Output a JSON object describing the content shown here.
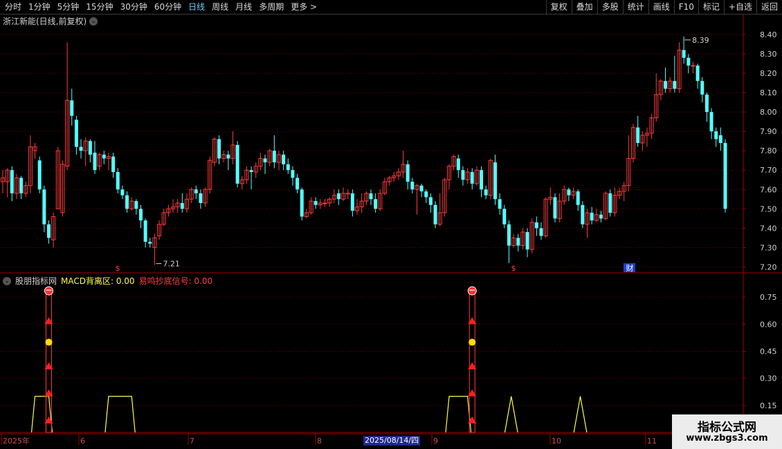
{
  "toolbar": {
    "left_items": [
      "分时",
      "1分钟",
      "5分钟",
      "15分钟",
      "30分钟",
      "60分钟",
      "日线",
      "周线",
      "月线",
      "多周期",
      "更多 >"
    ],
    "active_index": 6,
    "right_items": [
      "复权",
      "叠加",
      "多股",
      "统计",
      "画线",
      "F10",
      "标记",
      "+自选",
      "返回"
    ]
  },
  "main": {
    "title": "浙江新能(日线,前复权)",
    "high_label": "8.39",
    "low_label": "7.21",
    "markers": [
      "$",
      "$",
      "财"
    ],
    "y_ticks": [
      "8.40",
      "8.30",
      "8.20",
      "8.10",
      "8.00",
      "7.90",
      "7.80",
      "7.70",
      "7.60",
      "7.50",
      "7.40",
      "7.30",
      "7.20"
    ]
  },
  "sub": {
    "name": "股朋指标网",
    "line1": "MACD背离区: 0.00",
    "line2": "易鸣抄底信号: 0.00",
    "y_ticks": [
      "0.75",
      "0.60",
      "0.45",
      "0.30",
      "0.15"
    ]
  },
  "xaxis": {
    "labels": [
      "2025年",
      "6",
      "7",
      "8",
      "9",
      "10",
      "11"
    ],
    "selected_date": "2025/08/14/四"
  },
  "watermark": {
    "line1": "指标公式网",
    "line2": "www.zbgs3.com"
  },
  "colors": {
    "up": "#ff3b3b",
    "down": "#54ffff",
    "grid": "#7a0000",
    "axis": "#a00000",
    "yellow": "#ffff40"
  },
  "chart_data": {
    "type": "candlestick",
    "price_range": [
      7.18,
      8.45
    ],
    "indicator_range": [
      0,
      0.85
    ],
    "candles": [
      [
        7.64,
        7.66,
        7.58,
        7.7
      ],
      [
        7.64,
        7.7,
        7.56,
        7.71
      ],
      [
        7.7,
        7.58,
        7.54,
        7.72
      ],
      [
        7.58,
        7.66,
        7.55,
        7.68
      ],
      [
        7.66,
        7.58,
        7.55,
        7.67
      ],
      [
        7.58,
        7.62,
        7.56,
        7.64
      ],
      [
        7.62,
        7.82,
        7.58,
        7.88
      ],
      [
        7.8,
        7.82,
        7.76,
        7.84
      ],
      [
        7.75,
        7.6,
        7.58,
        7.77
      ],
      [
        7.6,
        7.42,
        7.38,
        7.62
      ],
      [
        7.42,
        7.35,
        7.32,
        7.44
      ],
      [
        7.34,
        7.46,
        7.3,
        7.48
      ],
      [
        7.5,
        7.8,
        7.5,
        7.82
      ],
      [
        7.48,
        7.73,
        7.46,
        7.75
      ],
      [
        7.72,
        8.06,
        7.7,
        8.36
      ],
      [
        8.06,
        7.98,
        7.93,
        8.12
      ],
      [
        7.96,
        7.82,
        7.78,
        7.98
      ],
      [
        7.82,
        7.8,
        7.76,
        7.86
      ],
      [
        7.8,
        7.85,
        7.72,
        7.87
      ],
      [
        7.85,
        7.78,
        7.74,
        7.86
      ],
      [
        7.79,
        7.7,
        7.68,
        7.85
      ],
      [
        7.72,
        7.78,
        7.7,
        7.79
      ],
      [
        7.78,
        7.76,
        7.73,
        7.8
      ],
      [
        7.76,
        7.77,
        7.7,
        7.79
      ],
      [
        7.77,
        7.69,
        7.66,
        7.79
      ],
      [
        7.69,
        7.6,
        7.58,
        7.71
      ],
      [
        7.6,
        7.57,
        7.55,
        7.62
      ],
      [
        7.57,
        7.5,
        7.48,
        7.59
      ],
      [
        7.5,
        7.54,
        7.49,
        7.56
      ],
      [
        7.54,
        7.5,
        7.47,
        7.55
      ],
      [
        7.5,
        7.44,
        7.4,
        7.52
      ],
      [
        7.44,
        7.33,
        7.3,
        7.45
      ],
      [
        7.33,
        7.32,
        7.3,
        7.35
      ],
      [
        7.3,
        7.35,
        7.21,
        7.37
      ],
      [
        7.36,
        7.42,
        7.34,
        7.44
      ],
      [
        7.42,
        7.48,
        7.41,
        7.5
      ],
      [
        7.48,
        7.5,
        7.46,
        7.52
      ],
      [
        7.5,
        7.51,
        7.48,
        7.55
      ],
      [
        7.51,
        7.53,
        7.48,
        7.55
      ],
      [
        7.53,
        7.5,
        7.48,
        7.58
      ],
      [
        7.5,
        7.55,
        7.48,
        7.58
      ],
      [
        7.55,
        7.6,
        7.53,
        7.61
      ],
      [
        7.6,
        7.58,
        7.55,
        7.62
      ],
      [
        7.58,
        7.53,
        7.5,
        7.6
      ],
      [
        7.53,
        7.6,
        7.51,
        7.61
      ],
      [
        7.6,
        7.75,
        7.58,
        7.77
      ],
      [
        7.74,
        7.86,
        7.72,
        7.87
      ],
      [
        7.86,
        7.76,
        7.73,
        7.88
      ],
      [
        7.76,
        7.78,
        7.74,
        7.8
      ],
      [
        7.78,
        7.76,
        7.7,
        7.8
      ],
      [
        7.76,
        7.83,
        7.73,
        7.9
      ],
      [
        7.83,
        7.63,
        7.61,
        7.85
      ],
      [
        7.63,
        7.65,
        7.6,
        7.67
      ],
      [
        7.65,
        7.7,
        7.63,
        7.72
      ],
      [
        7.7,
        7.69,
        7.6,
        7.72
      ],
      [
        7.69,
        7.72,
        7.66,
        7.74
      ],
      [
        7.72,
        7.76,
        7.7,
        7.79
      ],
      [
        7.76,
        7.74,
        7.68,
        7.78
      ],
      [
        7.74,
        7.8,
        7.72,
        7.81
      ],
      [
        7.8,
        7.74,
        7.71,
        7.88
      ],
      [
        7.74,
        7.78,
        7.7,
        7.8
      ],
      [
        7.78,
        7.73,
        7.7,
        7.8
      ],
      [
        7.73,
        7.7,
        7.68,
        7.76
      ],
      [
        7.7,
        7.66,
        7.62,
        7.72
      ],
      [
        7.66,
        7.6,
        7.58,
        7.68
      ],
      [
        7.6,
        7.46,
        7.44,
        7.61
      ],
      [
        7.46,
        7.48,
        7.45,
        7.5
      ],
      [
        7.48,
        7.54,
        7.47,
        7.56
      ],
      [
        7.54,
        7.52,
        7.5,
        7.56
      ],
      [
        7.52,
        7.53,
        7.5,
        7.55
      ],
      [
        7.53,
        7.53,
        7.51,
        7.55
      ],
      [
        7.53,
        7.55,
        7.51,
        7.56
      ],
      [
        7.55,
        7.57,
        7.53,
        7.6
      ],
      [
        7.58,
        7.55,
        7.52,
        7.6
      ],
      [
        7.55,
        7.58,
        7.54,
        7.61
      ],
      [
        7.58,
        7.58,
        7.55,
        7.6
      ],
      [
        7.58,
        7.49,
        7.46,
        7.6
      ],
      [
        7.49,
        7.51,
        7.47,
        7.55
      ],
      [
        7.51,
        7.54,
        7.48,
        7.58
      ],
      [
        7.54,
        7.58,
        7.52,
        7.59
      ],
      [
        7.58,
        7.55,
        7.52,
        7.6
      ],
      [
        7.55,
        7.5,
        7.48,
        7.58
      ],
      [
        7.5,
        7.58,
        7.49,
        7.6
      ],
      [
        7.58,
        7.64,
        7.57,
        7.66
      ],
      [
        7.64,
        7.66,
        7.62,
        7.67
      ],
      [
        7.66,
        7.67,
        7.64,
        7.69
      ],
      [
        7.67,
        7.69,
        7.65,
        7.71
      ],
      [
        7.69,
        7.73,
        7.66,
        7.8
      ],
      [
        7.73,
        7.64,
        7.6,
        7.75
      ],
      [
        7.64,
        7.6,
        7.58,
        7.66
      ],
      [
        7.6,
        7.62,
        7.47,
        7.63
      ],
      [
        7.62,
        7.59,
        7.56,
        7.63
      ],
      [
        7.59,
        7.56,
        7.53,
        7.6
      ],
      [
        7.56,
        7.52,
        7.48,
        7.58
      ],
      [
        7.52,
        7.42,
        7.4,
        7.54
      ],
      [
        7.42,
        7.48,
        7.41,
        7.58
      ],
      [
        7.48,
        7.65,
        7.46,
        7.66
      ],
      [
        7.65,
        7.72,
        7.6,
        7.73
      ],
      [
        7.72,
        7.77,
        7.7,
        7.78
      ],
      [
        7.76,
        7.7,
        7.66,
        7.78
      ],
      [
        7.7,
        7.65,
        7.62,
        7.72
      ],
      [
        7.65,
        7.69,
        7.63,
        7.71
      ],
      [
        7.69,
        7.63,
        7.6,
        7.71
      ],
      [
        7.63,
        7.7,
        7.62,
        7.72
      ],
      [
        7.7,
        7.6,
        7.56,
        7.72
      ],
      [
        7.6,
        7.57,
        7.55,
        7.62
      ],
      [
        7.57,
        7.75,
        7.55,
        7.76
      ],
      [
        7.74,
        7.55,
        7.52,
        7.78
      ],
      [
        7.55,
        7.5,
        7.47,
        7.58
      ],
      [
        7.5,
        7.42,
        7.4,
        7.52
      ],
      [
        7.42,
        7.31,
        7.22,
        7.44
      ],
      [
        7.31,
        7.35,
        7.3,
        7.37
      ],
      [
        7.35,
        7.31,
        7.28,
        7.37
      ],
      [
        7.31,
        7.38,
        7.29,
        7.4
      ],
      [
        7.38,
        7.29,
        7.25,
        7.4
      ],
      [
        7.29,
        7.43,
        7.27,
        7.45
      ],
      [
        7.43,
        7.4,
        7.36,
        7.46
      ],
      [
        7.4,
        7.36,
        7.34,
        7.43
      ],
      [
        7.36,
        7.55,
        7.35,
        7.56
      ],
      [
        7.55,
        7.56,
        7.52,
        7.61
      ],
      [
        7.56,
        7.45,
        7.43,
        7.58
      ],
      [
        7.45,
        7.54,
        7.43,
        7.58
      ],
      [
        7.54,
        7.6,
        7.52,
        7.62
      ],
      [
        7.6,
        7.57,
        7.54,
        7.61
      ],
      [
        7.57,
        7.59,
        7.55,
        7.61
      ],
      [
        7.59,
        7.52,
        7.49,
        7.6
      ],
      [
        7.52,
        7.42,
        7.4,
        7.54
      ],
      [
        7.42,
        7.48,
        7.35,
        7.5
      ],
      [
        7.48,
        7.44,
        7.42,
        7.51
      ],
      [
        7.44,
        7.47,
        7.43,
        7.5
      ],
      [
        7.47,
        7.45,
        7.43,
        7.49
      ],
      [
        7.45,
        7.58,
        7.44,
        7.59
      ],
      [
        7.58,
        7.48,
        7.46,
        7.6
      ],
      [
        7.48,
        7.57,
        7.46,
        7.61
      ],
      [
        7.57,
        7.59,
        7.55,
        7.61
      ],
      [
        7.59,
        7.62,
        7.54,
        7.64
      ],
      [
        7.62,
        7.76,
        7.59,
        7.88
      ],
      [
        7.76,
        7.92,
        7.74,
        7.94
      ],
      [
        7.92,
        7.84,
        7.82,
        7.98
      ],
      [
        7.84,
        7.88,
        7.8,
        7.9
      ],
      [
        7.88,
        7.89,
        7.82,
        7.92
      ],
      [
        7.89,
        7.97,
        7.86,
        7.99
      ],
      [
        7.97,
        8.09,
        7.95,
        8.2
      ],
      [
        8.09,
        8.16,
        8.06,
        8.17
      ],
      [
        8.16,
        8.12,
        8.1,
        8.23
      ],
      [
        8.12,
        8.16,
        8.1,
        8.18
      ],
      [
        8.16,
        8.12,
        8.1,
        8.29
      ],
      [
        8.12,
        8.32,
        8.1,
        8.36
      ],
      [
        8.32,
        8.28,
        8.25,
        8.39
      ],
      [
        8.28,
        8.24,
        8.2,
        8.3
      ],
      [
        8.24,
        8.24,
        8.2,
        8.26
      ],
      [
        8.24,
        8.16,
        8.12,
        8.25
      ],
      [
        8.16,
        8.09,
        8.05,
        8.18
      ],
      [
        8.09,
        8.0,
        7.95,
        8.1
      ],
      [
        8.0,
        7.9,
        7.86,
        8.02
      ],
      [
        7.9,
        7.86,
        7.82,
        7.92
      ],
      [
        7.88,
        7.84,
        7.8,
        7.92
      ],
      [
        7.84,
        7.5,
        7.48,
        7.86
      ]
    ],
    "macd_divergence_zones": [
      [
        7,
        10
      ],
      [
        23,
        28
      ],
      [
        97,
        101
      ],
      [
        110,
        111
      ],
      [
        125,
        126
      ]
    ],
    "bottom_signal_bars": [
      10,
      102
    ],
    "bottom_signal_value": 0.8
  }
}
